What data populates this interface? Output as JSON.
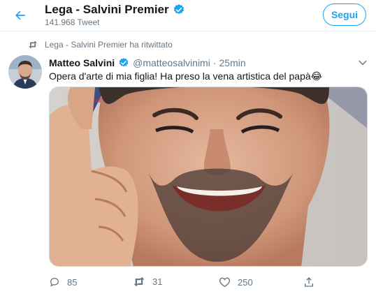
{
  "header": {
    "title": "Lega - Salvini Premier",
    "tweet_count": "141.968 Tweet",
    "follow_label": "Segui"
  },
  "retweet_notice": "Lega - Salvini Premier ha ritwittato",
  "tweet": {
    "author_name": "Matteo Salvini",
    "handle": "@matteosalvinimi",
    "separator": "·",
    "time": "25min",
    "text": "Opera d'arte di mia figlia! Ha preso la vena artistica del papà",
    "emoji": "😂",
    "actions": {
      "replies": "85",
      "retweets": "31",
      "likes": "250"
    }
  },
  "colors": {
    "accent": "#1da1f2",
    "muted_text": "#657786",
    "primary_text": "#14171a",
    "verified": "#1da1f2"
  },
  "icons": [
    "back-arrow-icon",
    "verified-badge-icon",
    "retweet-icon",
    "chevron-down-icon",
    "reply-icon",
    "like-icon",
    "share-icon"
  ]
}
